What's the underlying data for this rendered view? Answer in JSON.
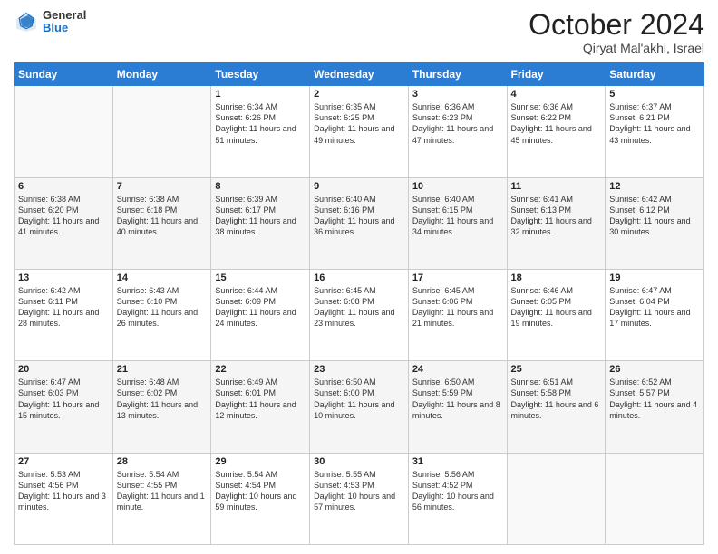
{
  "header": {
    "logo": {
      "general": "General",
      "blue": "Blue"
    },
    "title": "October 2024",
    "subtitle": "Qiryat Mal'akhi, Israel"
  },
  "weekdays": [
    "Sunday",
    "Monday",
    "Tuesday",
    "Wednesday",
    "Thursday",
    "Friday",
    "Saturday"
  ],
  "weeks": [
    [
      {
        "day": "",
        "info": ""
      },
      {
        "day": "",
        "info": ""
      },
      {
        "day": "1",
        "info": "Sunrise: 6:34 AM\nSunset: 6:26 PM\nDaylight: 11 hours and 51 minutes."
      },
      {
        "day": "2",
        "info": "Sunrise: 6:35 AM\nSunset: 6:25 PM\nDaylight: 11 hours and 49 minutes."
      },
      {
        "day": "3",
        "info": "Sunrise: 6:36 AM\nSunset: 6:23 PM\nDaylight: 11 hours and 47 minutes."
      },
      {
        "day": "4",
        "info": "Sunrise: 6:36 AM\nSunset: 6:22 PM\nDaylight: 11 hours and 45 minutes."
      },
      {
        "day": "5",
        "info": "Sunrise: 6:37 AM\nSunset: 6:21 PM\nDaylight: 11 hours and 43 minutes."
      }
    ],
    [
      {
        "day": "6",
        "info": "Sunrise: 6:38 AM\nSunset: 6:20 PM\nDaylight: 11 hours and 41 minutes."
      },
      {
        "day": "7",
        "info": "Sunrise: 6:38 AM\nSunset: 6:18 PM\nDaylight: 11 hours and 40 minutes."
      },
      {
        "day": "8",
        "info": "Sunrise: 6:39 AM\nSunset: 6:17 PM\nDaylight: 11 hours and 38 minutes."
      },
      {
        "day": "9",
        "info": "Sunrise: 6:40 AM\nSunset: 6:16 PM\nDaylight: 11 hours and 36 minutes."
      },
      {
        "day": "10",
        "info": "Sunrise: 6:40 AM\nSunset: 6:15 PM\nDaylight: 11 hours and 34 minutes."
      },
      {
        "day": "11",
        "info": "Sunrise: 6:41 AM\nSunset: 6:13 PM\nDaylight: 11 hours and 32 minutes."
      },
      {
        "day": "12",
        "info": "Sunrise: 6:42 AM\nSunset: 6:12 PM\nDaylight: 11 hours and 30 minutes."
      }
    ],
    [
      {
        "day": "13",
        "info": "Sunrise: 6:42 AM\nSunset: 6:11 PM\nDaylight: 11 hours and 28 minutes."
      },
      {
        "day": "14",
        "info": "Sunrise: 6:43 AM\nSunset: 6:10 PM\nDaylight: 11 hours and 26 minutes."
      },
      {
        "day": "15",
        "info": "Sunrise: 6:44 AM\nSunset: 6:09 PM\nDaylight: 11 hours and 24 minutes."
      },
      {
        "day": "16",
        "info": "Sunrise: 6:45 AM\nSunset: 6:08 PM\nDaylight: 11 hours and 23 minutes."
      },
      {
        "day": "17",
        "info": "Sunrise: 6:45 AM\nSunset: 6:06 PM\nDaylight: 11 hours and 21 minutes."
      },
      {
        "day": "18",
        "info": "Sunrise: 6:46 AM\nSunset: 6:05 PM\nDaylight: 11 hours and 19 minutes."
      },
      {
        "day": "19",
        "info": "Sunrise: 6:47 AM\nSunset: 6:04 PM\nDaylight: 11 hours and 17 minutes."
      }
    ],
    [
      {
        "day": "20",
        "info": "Sunrise: 6:47 AM\nSunset: 6:03 PM\nDaylight: 11 hours and 15 minutes."
      },
      {
        "day": "21",
        "info": "Sunrise: 6:48 AM\nSunset: 6:02 PM\nDaylight: 11 hours and 13 minutes."
      },
      {
        "day": "22",
        "info": "Sunrise: 6:49 AM\nSunset: 6:01 PM\nDaylight: 11 hours and 12 minutes."
      },
      {
        "day": "23",
        "info": "Sunrise: 6:50 AM\nSunset: 6:00 PM\nDaylight: 11 hours and 10 minutes."
      },
      {
        "day": "24",
        "info": "Sunrise: 6:50 AM\nSunset: 5:59 PM\nDaylight: 11 hours and 8 minutes."
      },
      {
        "day": "25",
        "info": "Sunrise: 6:51 AM\nSunset: 5:58 PM\nDaylight: 11 hours and 6 minutes."
      },
      {
        "day": "26",
        "info": "Sunrise: 6:52 AM\nSunset: 5:57 PM\nDaylight: 11 hours and 4 minutes."
      }
    ],
    [
      {
        "day": "27",
        "info": "Sunrise: 5:53 AM\nSunset: 4:56 PM\nDaylight: 11 hours and 3 minutes."
      },
      {
        "day": "28",
        "info": "Sunrise: 5:54 AM\nSunset: 4:55 PM\nDaylight: 11 hours and 1 minute."
      },
      {
        "day": "29",
        "info": "Sunrise: 5:54 AM\nSunset: 4:54 PM\nDaylight: 10 hours and 59 minutes."
      },
      {
        "day": "30",
        "info": "Sunrise: 5:55 AM\nSunset: 4:53 PM\nDaylight: 10 hours and 57 minutes."
      },
      {
        "day": "31",
        "info": "Sunrise: 5:56 AM\nSunset: 4:52 PM\nDaylight: 10 hours and 56 minutes."
      },
      {
        "day": "",
        "info": ""
      },
      {
        "day": "",
        "info": ""
      }
    ]
  ]
}
